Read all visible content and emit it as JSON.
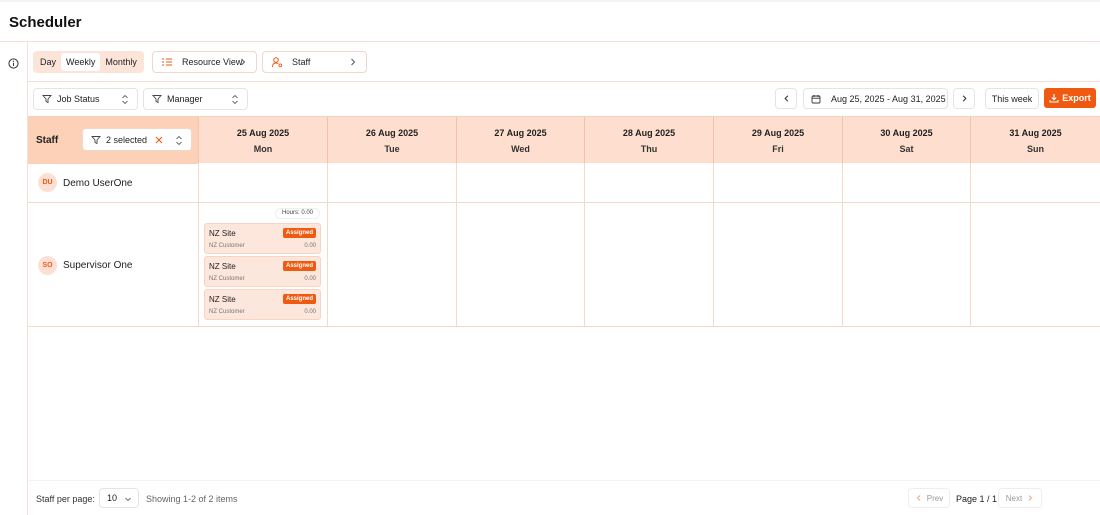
{
  "app": {
    "title": "Scheduler"
  },
  "views": {
    "segments": [
      "Day",
      "Weekly",
      "Monthly"
    ],
    "active": "Weekly",
    "resource_view_label": "Resource View",
    "staff_label": "Staff"
  },
  "filters": {
    "job_status_label": "Job Status",
    "manager_label": "Manager",
    "date_range": "Aug 25, 2025 - Aug 31, 2025",
    "this_week_label": "This week",
    "export_label": "Export"
  },
  "grid": {
    "staff_header": "Staff",
    "staff_filter_value": "2 selected",
    "days": [
      {
        "date": "25 Aug 2025",
        "weekday": "Mon"
      },
      {
        "date": "26 Aug 2025",
        "weekday": "Tue"
      },
      {
        "date": "27 Aug 2025",
        "weekday": "Wed"
      },
      {
        "date": "28 Aug 2025",
        "weekday": "Thu"
      },
      {
        "date": "29 Aug 2025",
        "weekday": "Fri"
      },
      {
        "date": "30 Aug 2025",
        "weekday": "Sat"
      },
      {
        "date": "31 Aug 2025",
        "weekday": "Sun"
      }
    ],
    "staff": [
      {
        "initials": "DU",
        "name": "Demo UserOne"
      },
      {
        "initials": "SO",
        "name": "Supervisor One",
        "hours_label": "Hours: 0.00",
        "jobs": [
          {
            "site": "NZ Site",
            "status": "Assigned",
            "customer": "NZ Customer",
            "value": "0.00"
          },
          {
            "site": "NZ Site",
            "status": "Assigned",
            "customer": "NZ Customer",
            "value": "0.00"
          },
          {
            "site": "NZ Site",
            "status": "Assigned",
            "customer": "NZ Customer",
            "value": "0.00"
          }
        ]
      }
    ]
  },
  "footer": {
    "per_page_label": "Staff per page:",
    "per_page_value": "10",
    "showing": "Showing 1-2 of 2 items",
    "prev_label": "Prev",
    "page_info": "Page 1 / 1",
    "next_label": "Next"
  },
  "colors": {
    "accent": "#ef5a10",
    "header_bg": "#fedfcf",
    "staff_header_bg": "#fcd1b7",
    "job_bg": "#fde6dc"
  }
}
